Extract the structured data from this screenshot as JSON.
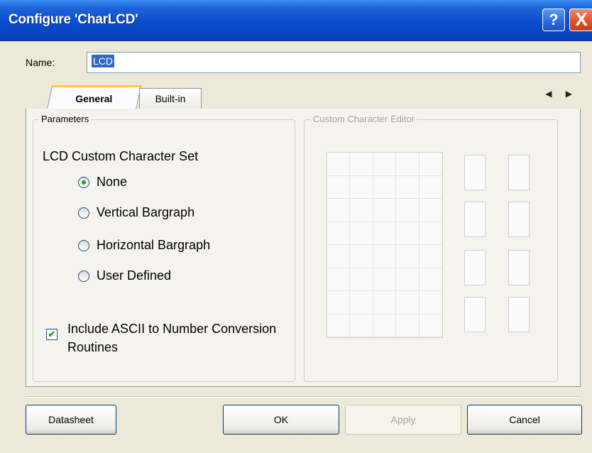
{
  "window": {
    "title": "Configure 'CharLCD'",
    "help_label": "?",
    "close_label": "X"
  },
  "name_field": {
    "label": "Name:",
    "value": "LCD"
  },
  "tabs": [
    {
      "label": "General",
      "active": true
    },
    {
      "label": "Built-in",
      "active": false
    }
  ],
  "tab_scroll": "◀ ▶",
  "parameters": {
    "group_title": "Parameters",
    "set_label": "LCD Custom Character Set",
    "options": [
      {
        "label": "None",
        "selected": true
      },
      {
        "label": "Vertical Bargraph",
        "selected": false
      },
      {
        "label": "Horizontal Bargraph",
        "selected": false
      },
      {
        "label": "User Defined",
        "selected": false
      }
    ],
    "checkbox": {
      "label": "Include ASCII to Number Conversion Routines",
      "checked": true
    }
  },
  "editor": {
    "group_title": "Custom Character Editor",
    "enabled": false
  },
  "buttons": {
    "datasheet": "Datasheet",
    "ok": "OK",
    "apply": "Apply",
    "cancel": "Cancel"
  }
}
